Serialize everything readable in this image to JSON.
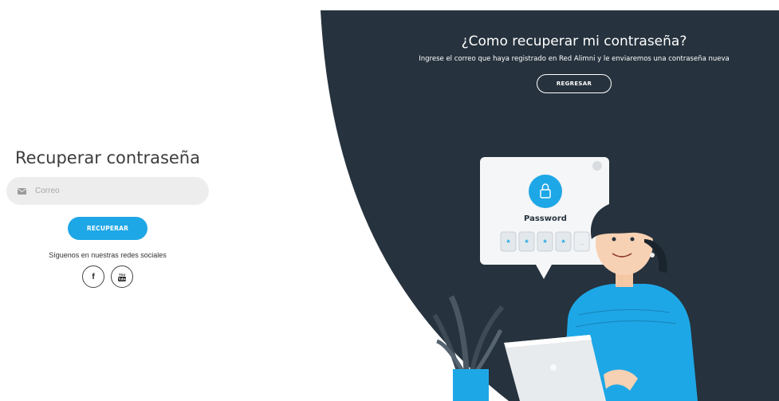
{
  "hero": {
    "title": "¿Como recuperar mi contraseña?",
    "subtitle": "Ingrese el correo que haya registrado en Red Alimni y le enviaremos una contraseña nueva",
    "back_label": "REGRESAR"
  },
  "form": {
    "title": "Recuperar contraseña",
    "email_placeholder": "Correo",
    "submit_label": "RECUPERAR",
    "social_text": "Síguenos en nuestras redes sociales",
    "facebook_glyph": "f",
    "youtube_glyph": "You Tube"
  },
  "illustration": {
    "card_title": "Password",
    "masked_chars": [
      "*",
      "*",
      "*",
      "*"
    ],
    "last_char": "..."
  },
  "colors": {
    "hero_bg": "#26323d",
    "accent": "#1ea7e6",
    "input_bg": "#ededed"
  }
}
